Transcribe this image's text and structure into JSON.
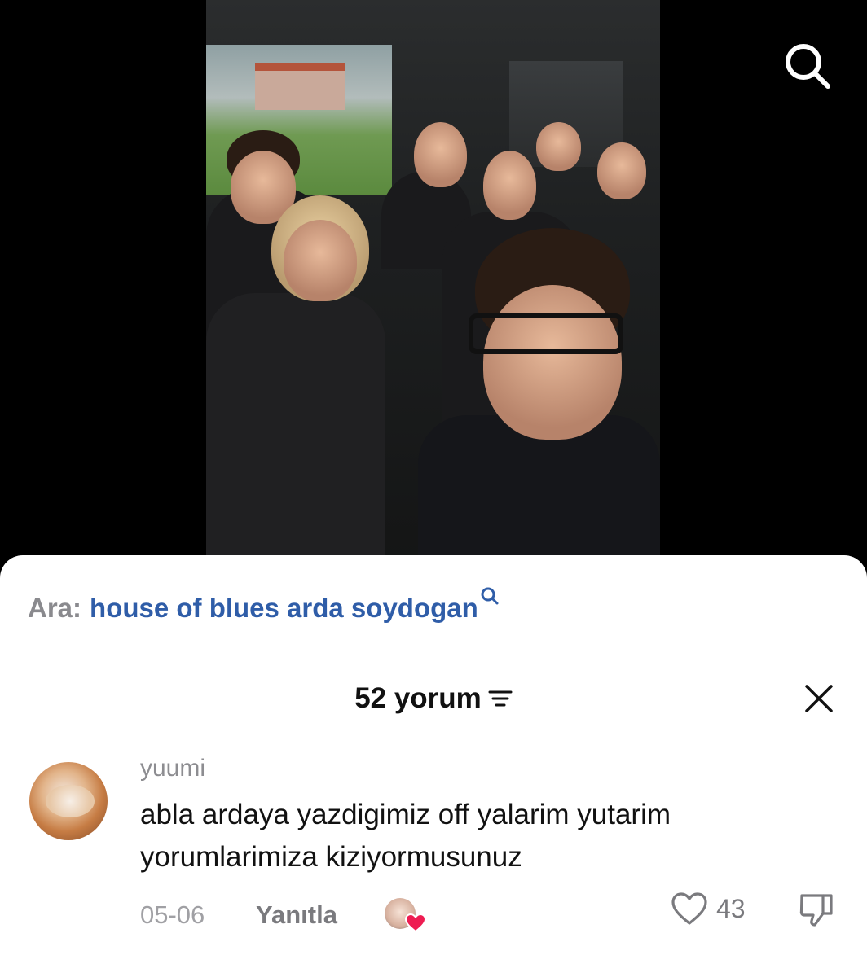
{
  "search": {
    "label": "Ara:",
    "query": "house of blues arda soydogan"
  },
  "comments": {
    "count_label": "52 yorum"
  },
  "comment": {
    "username": "yuumi",
    "text": "abla ardaya yazdigimiz off yalarim yutarim yorumlarimiza kiziyormusunuz",
    "date": "05-06",
    "reply_label": "Yanıtla",
    "like_count": "43"
  },
  "colors": {
    "search_query": "#2f5da8",
    "liked_heart": "#ee1d52"
  },
  "icons": {
    "top_search": "search-icon",
    "close": "close-icon",
    "sort": "sort-icon",
    "like": "heart-outline-icon",
    "dislike": "thumbs-down-icon"
  }
}
